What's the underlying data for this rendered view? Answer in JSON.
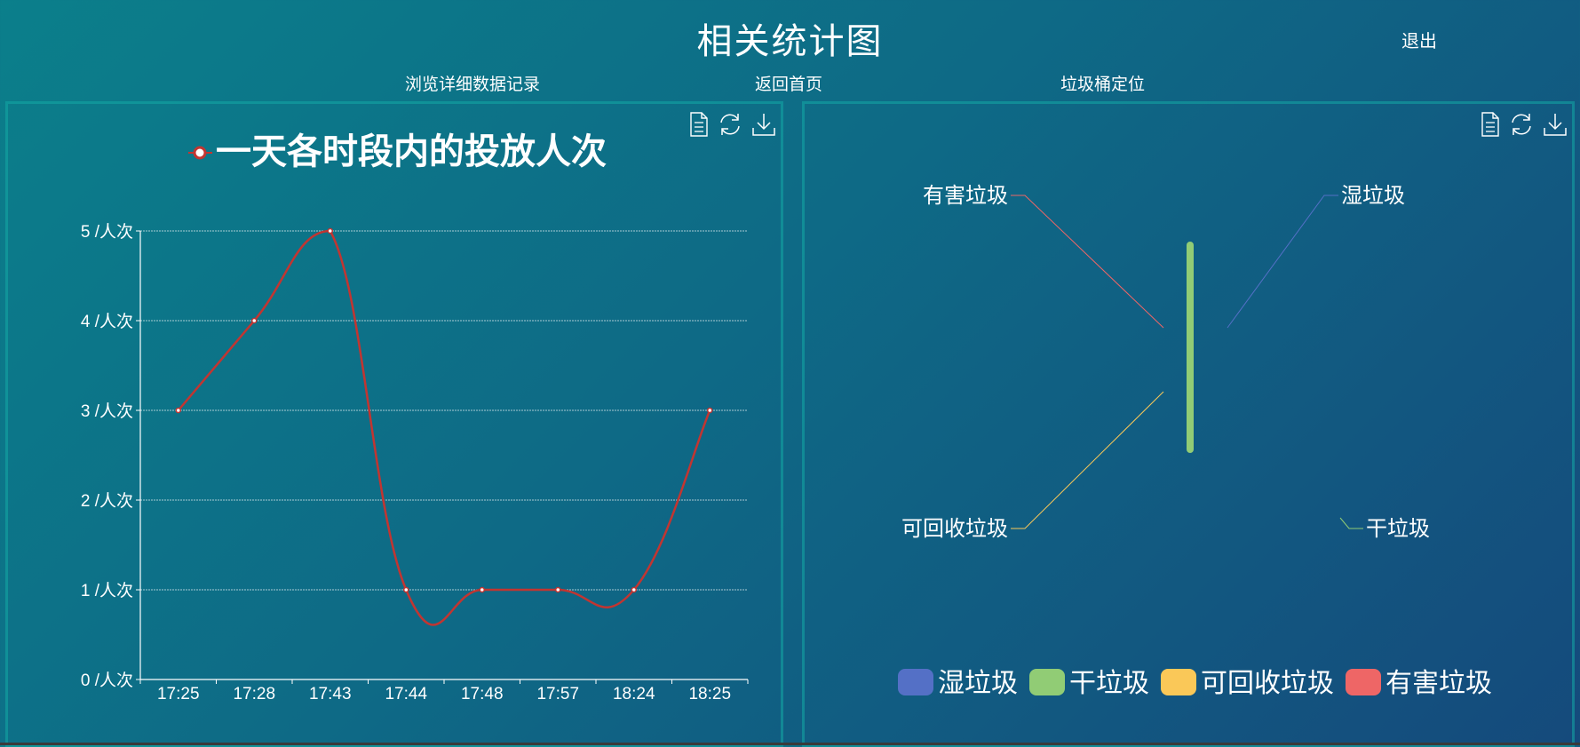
{
  "header": {
    "title": "相关统计图",
    "logout_label": "退出"
  },
  "nav": {
    "items": [
      {
        "label": "浏览详细数据记录"
      },
      {
        "label": "返回首页"
      },
      {
        "label": "垃圾桶定位"
      }
    ]
  },
  "colors": {
    "line": "#c23531",
    "wet": "#5470c6",
    "dry": "#91cc75",
    "recyclable": "#fac858",
    "harmful": "#ee6666"
  },
  "toolbox_icons": [
    "data-view-icon",
    "refresh-icon",
    "download-icon"
  ],
  "chart_data": [
    {
      "type": "line",
      "title": "一天各时段内的投放人次",
      "smooth": true,
      "categories": [
        "17:25",
        "17:28",
        "17:43",
        "17:44",
        "17:48",
        "17:57",
        "18:24",
        "18:25"
      ],
      "series": [
        {
          "name": "一天各时段内的投放人次",
          "values": [
            3,
            4,
            5,
            1,
            1,
            1,
            1,
            3
          ]
        }
      ],
      "ylim": [
        0,
        5
      ],
      "y_ticks": [
        0,
        1,
        2,
        3,
        4,
        5
      ],
      "y_tick_suffix": " /人次",
      "xlabel": "",
      "ylabel": "",
      "grid": true,
      "legend": "top-center"
    },
    {
      "type": "pie",
      "rose": true,
      "series": [
        {
          "name": "湿垃圾",
          "value": 0
        },
        {
          "name": "干垃圾",
          "value": 1
        },
        {
          "name": "可回收垃圾",
          "value": 0
        },
        {
          "name": "有害垃圾",
          "value": 0
        }
      ],
      "legend": "bottom-center"
    }
  ]
}
